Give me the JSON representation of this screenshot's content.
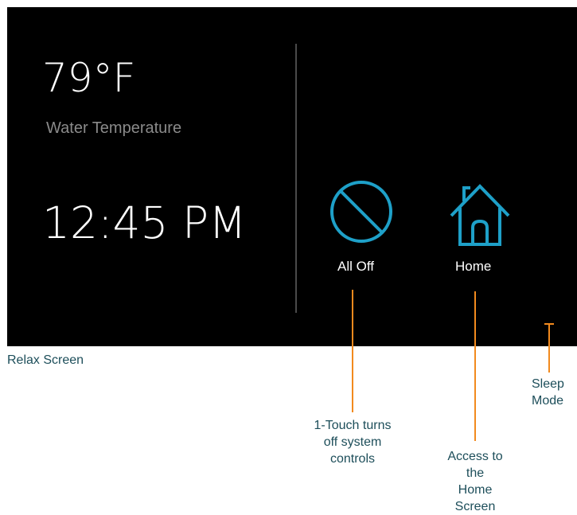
{
  "screen": {
    "temperature": "79°F",
    "temperature_label": "Water Temperature",
    "time": "12:45 PM",
    "buttons": {
      "all_off": {
        "label": "All Off",
        "icon": "no-symbol-icon"
      },
      "home": {
        "label": "Home",
        "icon": "house-icon"
      },
      "sleep": {
        "icon": "moon-icon"
      }
    },
    "colors": {
      "background": "#000000",
      "accent": "#1ea0c8",
      "secondary_text": "#8a8a8a",
      "divider": "#4a4a4a"
    }
  },
  "caption": "Relax Screen",
  "callouts": {
    "all_off": "1-Touch turns\noff system\ncontrols",
    "home": "Access to\nthe\nHome\nScreen",
    "sleep": "Sleep\nMode"
  },
  "callout_color": "#f28a1e"
}
